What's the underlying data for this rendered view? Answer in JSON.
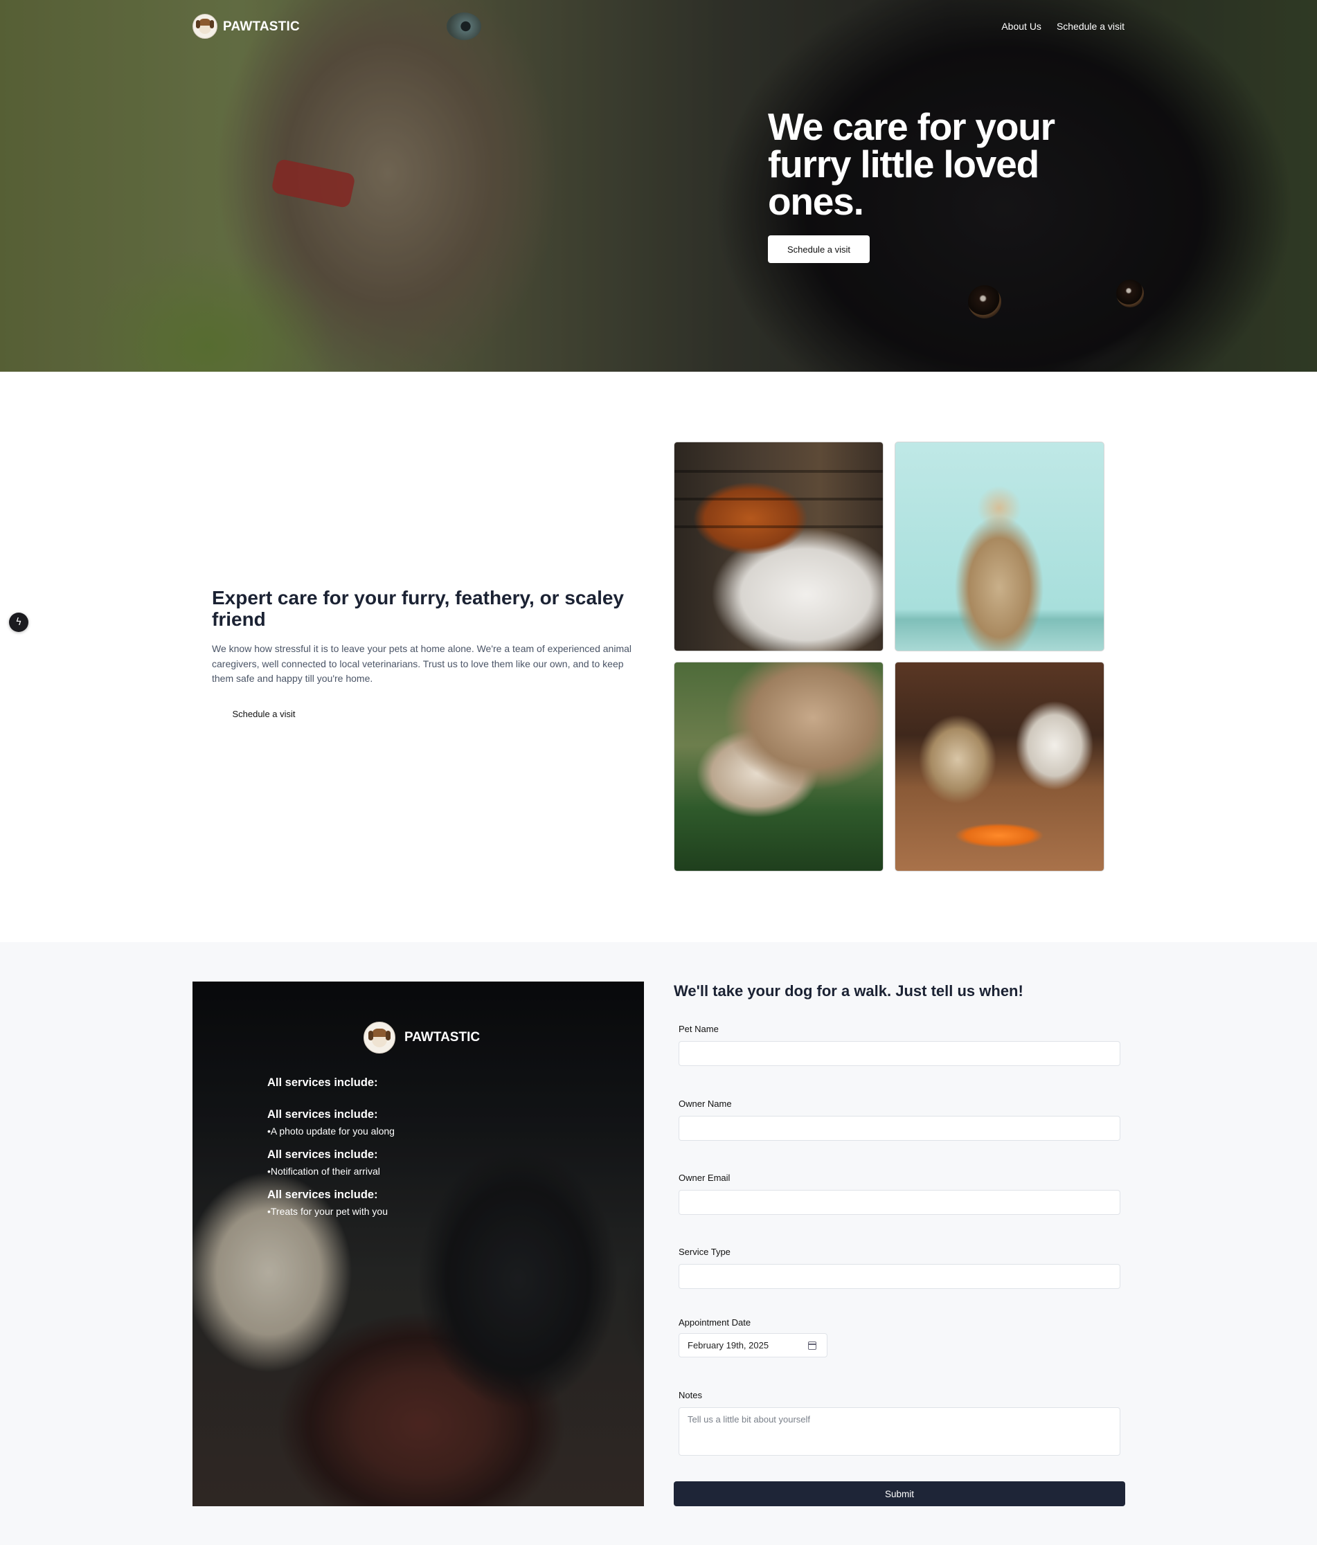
{
  "nav": {
    "brand": "PAWTASTIC",
    "links": [
      "About Us",
      "Schedule a visit"
    ]
  },
  "hero": {
    "title": "We care for your furry little loved ones.",
    "cta": "Schedule a visit"
  },
  "about": {
    "title": "Expert care for your furry, feathery, or scaley friend",
    "text": "We know how stressful it is to leave your pets at home alone. We're a team of experienced animal caregivers, well connected to local veterinarians. Trust us to love them like our own, and to keep them safe and happy till you're home.",
    "cta": "Schedule a visit"
  },
  "promo": {
    "brand": "PAWTASTIC",
    "heading": "All services include:",
    "items": [
      "•A photo update for you along",
      "•Notification of their arrival",
      "•Treats for your pet with you"
    ]
  },
  "form": {
    "title": "We'll take your dog for a walk. Just tell us when!",
    "fields": {
      "pet_name": "Pet Name",
      "owner_name": "Owner Name",
      "owner_email": "Owner Email",
      "service_type": "Service Type",
      "appointment_date": "Appointment Date",
      "notes": "Notes"
    },
    "date_value": "February 19th, 2025",
    "notes_placeholder": "Tell us a little bit about yourself",
    "submit": "Submit"
  },
  "icons": {
    "fab": "lightning-icon",
    "calendar": "calendar-icon",
    "logo": "dog-logo-icon"
  }
}
